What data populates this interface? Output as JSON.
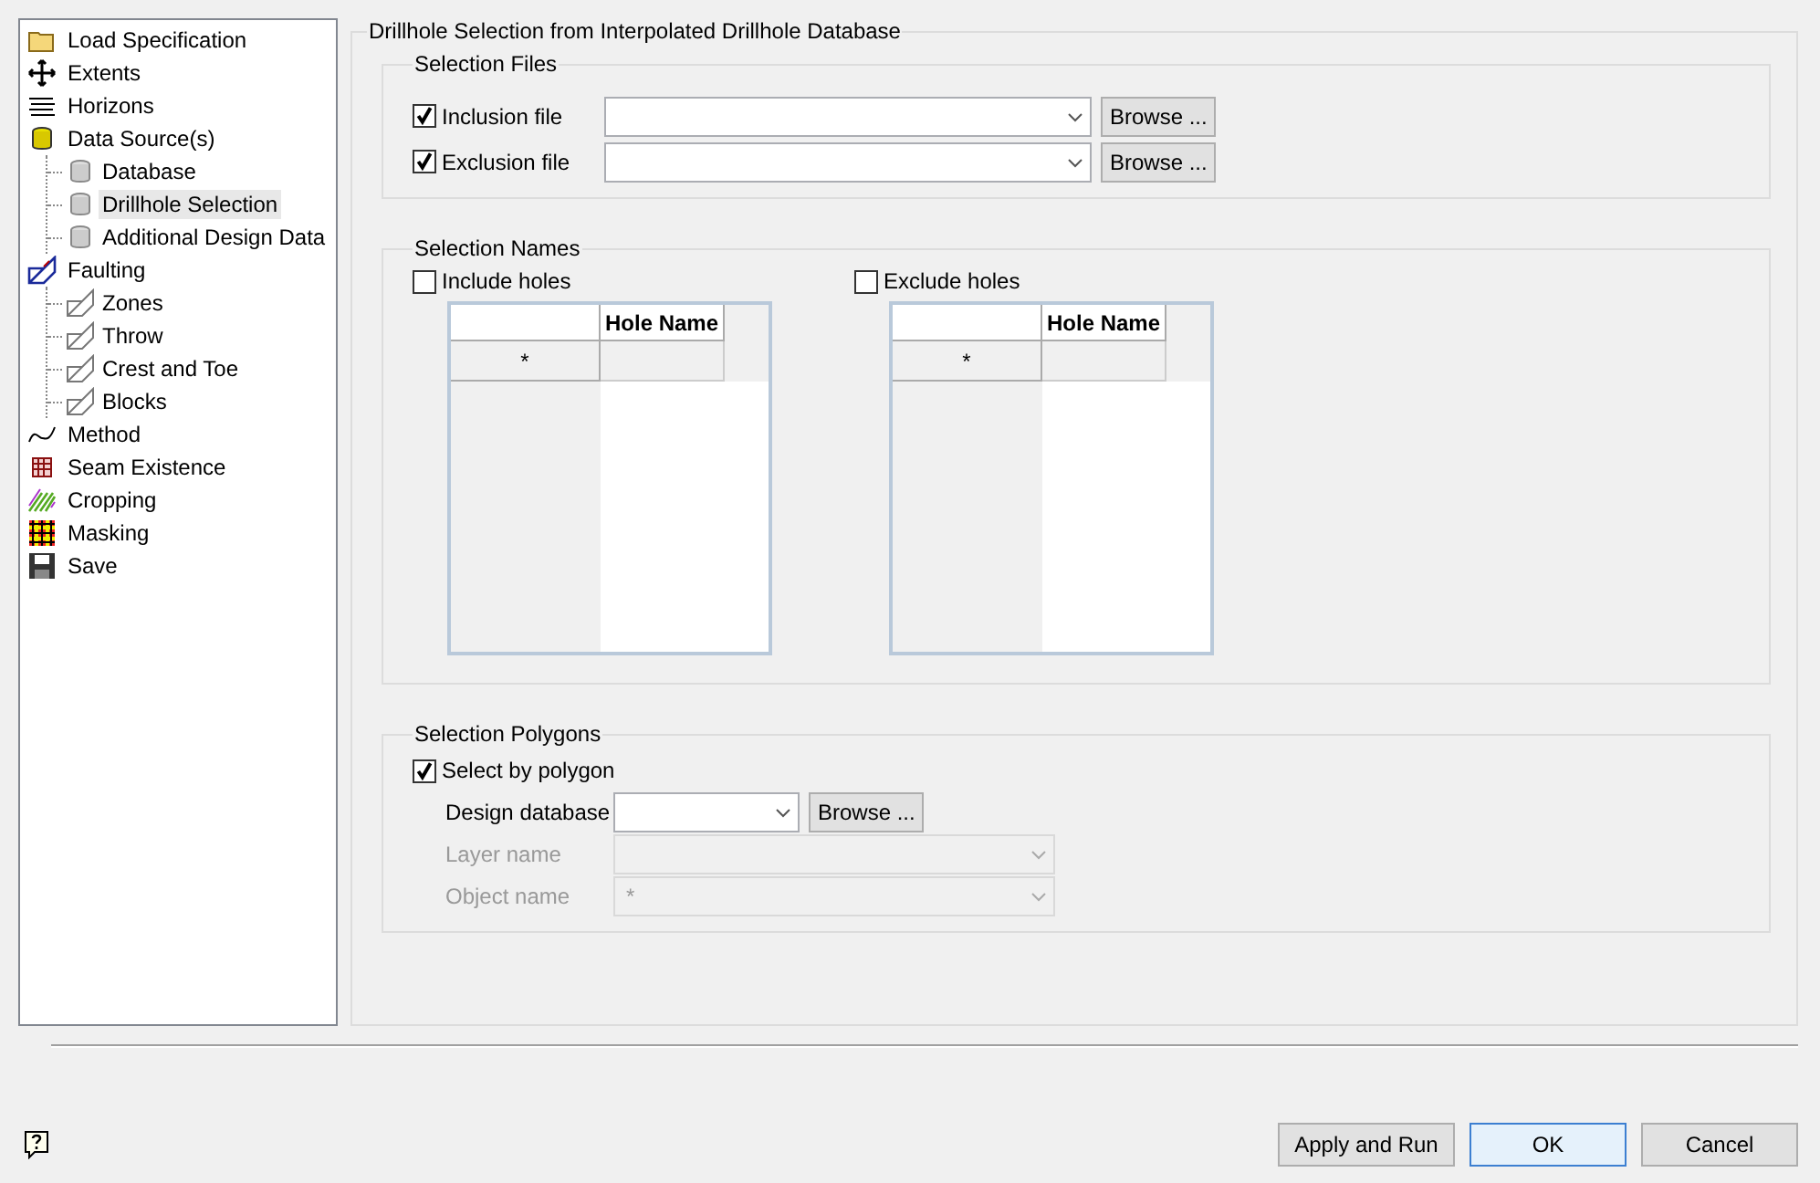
{
  "sidebar": {
    "items": [
      {
        "label": "Load Specification",
        "selected": false
      },
      {
        "label": "Extents",
        "selected": false
      },
      {
        "label": "Horizons",
        "selected": false
      },
      {
        "label": "Data Source(s)",
        "selected": false,
        "children": [
          {
            "label": "Database",
            "selected": false
          },
          {
            "label": "Drillhole Selection",
            "selected": true
          },
          {
            "label": "Additional Design Data",
            "selected": false
          }
        ]
      },
      {
        "label": "Faulting",
        "selected": false,
        "children": [
          {
            "label": "Zones",
            "selected": false
          },
          {
            "label": "Throw",
            "selected": false
          },
          {
            "label": "Crest and Toe",
            "selected": false
          },
          {
            "label": "Blocks",
            "selected": false
          }
        ]
      },
      {
        "label": "Method",
        "selected": false
      },
      {
        "label": "Seam Existence",
        "selected": false
      },
      {
        "label": "Cropping",
        "selected": false
      },
      {
        "label": "Masking",
        "selected": false
      },
      {
        "label": "Save",
        "selected": false
      }
    ]
  },
  "panel": {
    "title": "Drillhole Selection from Interpolated Drillhole Database",
    "selection_files": {
      "title": "Selection Files",
      "rows": [
        {
          "label": "Inclusion file",
          "checked": true,
          "button": "Browse ..."
        },
        {
          "label": "Exclusion file",
          "checked": true,
          "button": "Browse ..."
        }
      ]
    },
    "selection_names": {
      "title": "Selection Names",
      "lists": [
        {
          "label": "Include holes",
          "checked": false,
          "column": "Hole Name",
          "new_row_marker": "*"
        },
        {
          "label": "Exclude holes",
          "checked": false,
          "column": "Hole Name",
          "new_row_marker": "*"
        }
      ]
    },
    "selection_polygons": {
      "title": "Selection Polygons",
      "checkbox": {
        "label": "Select by polygon",
        "checked": true
      },
      "fields": [
        {
          "label": "Design database",
          "disabled": false,
          "button": "Browse ..."
        },
        {
          "label": "Layer name",
          "disabled": true
        },
        {
          "label": "Object name",
          "value": "*",
          "disabled": true
        }
      ]
    }
  },
  "buttons": [
    {
      "label": "Apply and Run",
      "default": false
    },
    {
      "label": "OK",
      "default": true
    },
    {
      "label": "Cancel",
      "default": false
    }
  ]
}
